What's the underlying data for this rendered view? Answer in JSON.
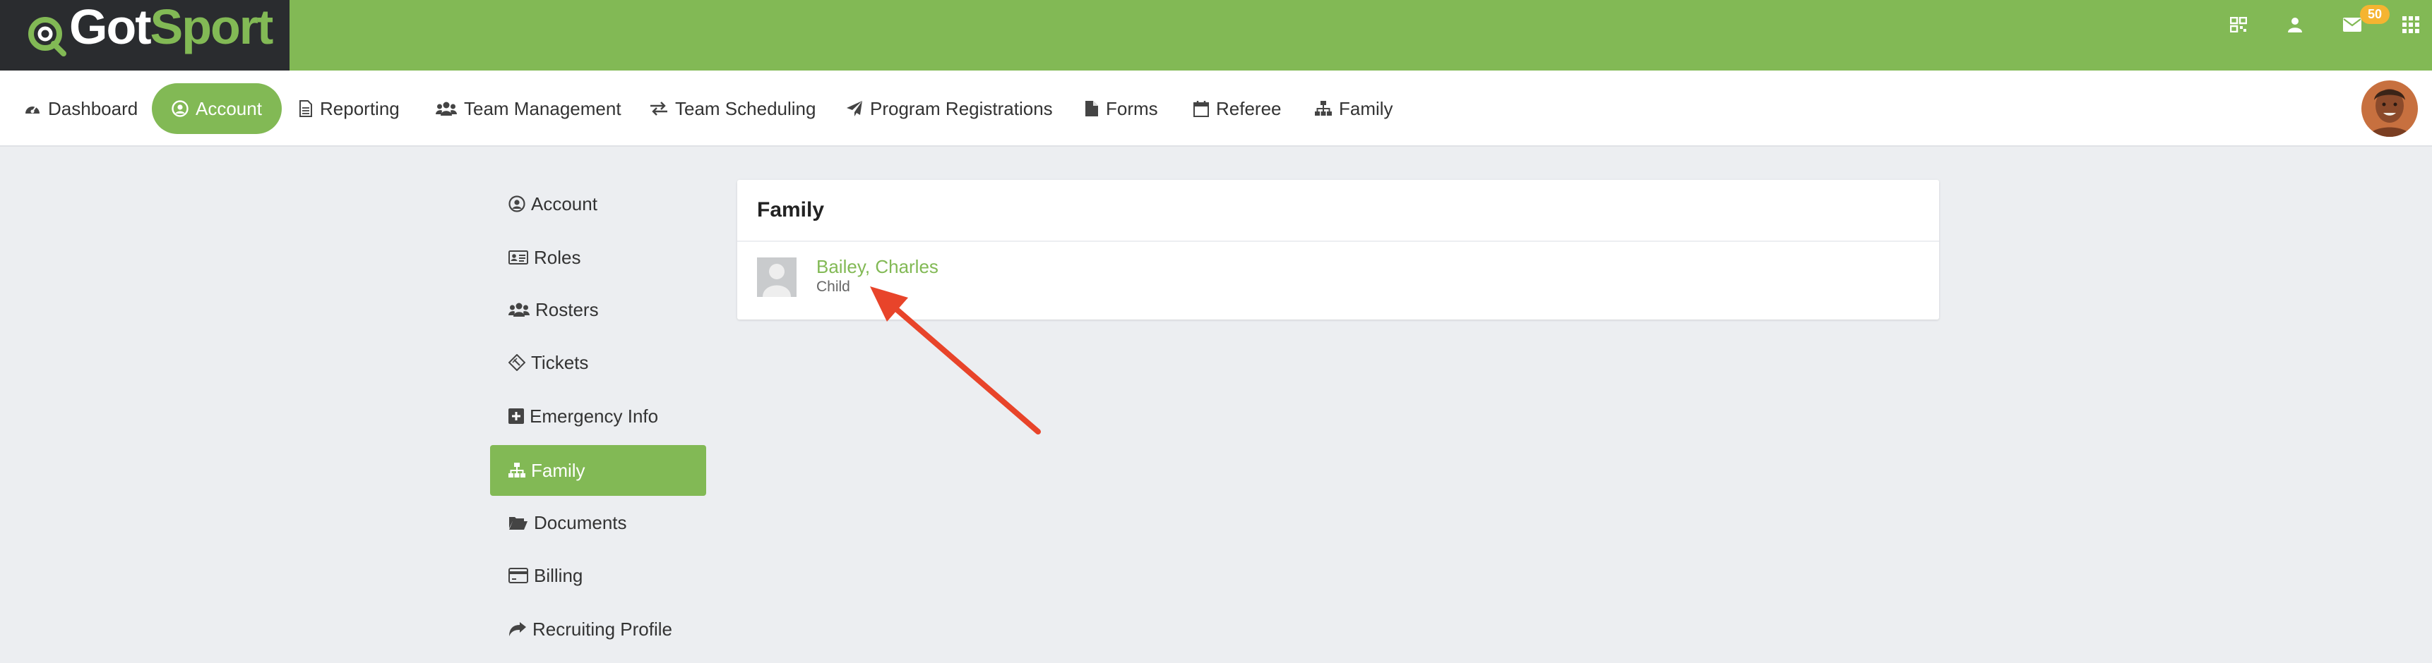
{
  "brand": {
    "name_part1": "Got",
    "name_part2": "Sport",
    "primary_color": "#82b955",
    "dark_color": "#2a2c2f"
  },
  "header": {
    "mail_badge": "50"
  },
  "nav": {
    "items": [
      {
        "label": "Dashboard",
        "icon": "dashboard-icon"
      },
      {
        "label": "Account",
        "icon": "user-circle-icon"
      },
      {
        "label": "Reporting",
        "icon": "document-icon"
      },
      {
        "label": "Team Management",
        "icon": "users-icon"
      },
      {
        "label": "Team Scheduling",
        "icon": "exchange-icon"
      },
      {
        "label": "Program Registrations",
        "icon": "paper-plane-icon"
      },
      {
        "label": "Forms",
        "icon": "file-icon"
      },
      {
        "label": "Referee",
        "icon": "calendar-icon"
      },
      {
        "label": "Family",
        "icon": "sitemap-icon"
      }
    ],
    "active": "Account"
  },
  "sidebar": {
    "items": [
      {
        "label": "Account",
        "icon": "user-circle-icon"
      },
      {
        "label": "Roles",
        "icon": "id-card-icon"
      },
      {
        "label": "Rosters",
        "icon": "users-icon"
      },
      {
        "label": "Tickets",
        "icon": "ticket-icon"
      },
      {
        "label": "Emergency Info",
        "icon": "plus-square-icon"
      },
      {
        "label": "Family",
        "icon": "sitemap-icon"
      },
      {
        "label": "Documents",
        "icon": "folder-open-icon"
      },
      {
        "label": "Billing",
        "icon": "credit-card-icon"
      },
      {
        "label": "Recruiting Profile",
        "icon": "share-icon"
      }
    ],
    "active": "Family"
  },
  "family_card": {
    "title": "Family",
    "members": [
      {
        "name": "Bailey, Charles",
        "relation": "Child"
      }
    ]
  },
  "annotation": {
    "arrow_color": "#e8442a"
  }
}
